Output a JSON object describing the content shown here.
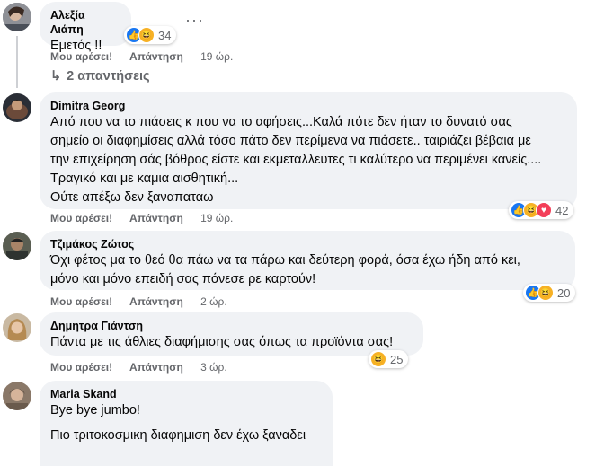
{
  "comments": [
    {
      "author": "Αλεξία Λιάπη",
      "lines": [
        "Εμετός !!"
      ],
      "like_label": "Μου αρέσει!",
      "reply_label": "Απάντηση",
      "time": "19 ώρ.",
      "reaction_count": "34",
      "reactions": [
        "like-icon",
        "haha-icon"
      ]
    },
    {
      "author": "Dimitra Georg",
      "lines": [
        "Από που να το πιάσεις κ που να το αφήσεις...Καλά πότε δεν ήταν το δυνατό σας",
        "σημείο οι διαφημίσεις αλλά τόσο πάτο δεν περίμενα να πιάσετε.. ταιριάζει βέβαια με",
        "την επιχείρηση σάς βόθρος είστε και εκμεταλλευτες τι καλύτερο να περιμένει κανείς....",
        "Τραγικό και με καμια αισθητική...",
        "Ούτε απέξω δεν ξαναπαταω"
      ],
      "like_label": "Μου αρέσει!",
      "reply_label": "Απάντηση",
      "time": "19 ώρ.",
      "reaction_count": "42",
      "reactions": [
        "like-icon",
        "haha-icon",
        "love-icon"
      ]
    },
    {
      "author": "Τζιμάκος Ζώτος",
      "lines": [
        "Όχι φέτος μα το θεό θα πάω να τα πάρω και δεύτερη φορά, όσα έχω ήδη από κει,",
        "μόνο και μόνο επειδή σας πόνεσε ρε καρτούν!"
      ],
      "like_label": "Μου αρέσει!",
      "reply_label": "Απάντηση",
      "time": "2 ώρ.",
      "reaction_count": "20",
      "reactions": [
        "like-icon",
        "haha-icon"
      ]
    },
    {
      "author": "Δημητρα Γιάντση",
      "lines": [
        "Πάντα με τις άθλιες διαφήμισης σας όπως τα προϊόντα σας!"
      ],
      "like_label": "Μου αρέσει!",
      "reply_label": "Απάντηση",
      "time": "3 ώρ.",
      "reaction_count": "25",
      "reactions": [
        "haha-icon"
      ]
    },
    {
      "author": "Maria Skand",
      "lines": [
        "Bye bye jumbo!",
        "",
        "Πιο τριτοκοσμικη διαφημιση δεν έχω ξαναδει"
      ]
    }
  ],
  "replies_toggle": "2 απαντήσεις",
  "more_options": "···"
}
